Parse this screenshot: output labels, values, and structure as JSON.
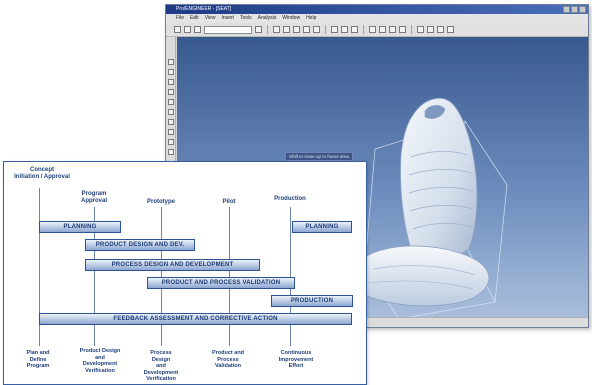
{
  "cad_window": {
    "title": "Pro/ENGINEER - [SEAT]",
    "menu_items": [
      "File",
      "Edit",
      "View",
      "Insert",
      "Tools",
      "Analysis",
      "Window",
      "Help"
    ],
    "tooltip": "Shift to close up to frame area",
    "viewport_colors": {
      "top": "#38598f",
      "bottom": "#a9bfdc"
    }
  },
  "process_chart": {
    "milestones": [
      {
        "label": "Concept\nInitiation / Approval"
      },
      {
        "label": "Program\nApproval"
      },
      {
        "label": "Prototype"
      },
      {
        "label": "Pilot"
      },
      {
        "label": "Production"
      }
    ],
    "bars": [
      {
        "label": "PLANNING"
      },
      {
        "label": "PLANNING"
      },
      {
        "label": "PRODUCT DESIGN AND DEV."
      },
      {
        "label": "PROCESS DESIGN AND DEVELOPMENT"
      },
      {
        "label": "PRODUCT AND PROCESS VALIDATION"
      },
      {
        "label": "PRODUCTION"
      },
      {
        "label": "FEEDBACK ASSESSMENT AND CORRECTIVE ACTION"
      }
    ],
    "deliverables": [
      {
        "label": "Plan and\nDefine\nProgram"
      },
      {
        "label": "Product Design\nand\nDevelopment\nVerification"
      },
      {
        "label": "Process\nDesign\nand\nDevelopment\nVerification"
      },
      {
        "label": "Product and\nProcess\nValidation"
      },
      {
        "label": "Continuous\nImprovement\nEffort"
      }
    ],
    "colors": {
      "bar_border": "#2e5392",
      "bar_fill": "#b7c8e3",
      "text": "#1f3f7a",
      "frame": "#3a5fa0"
    }
  }
}
